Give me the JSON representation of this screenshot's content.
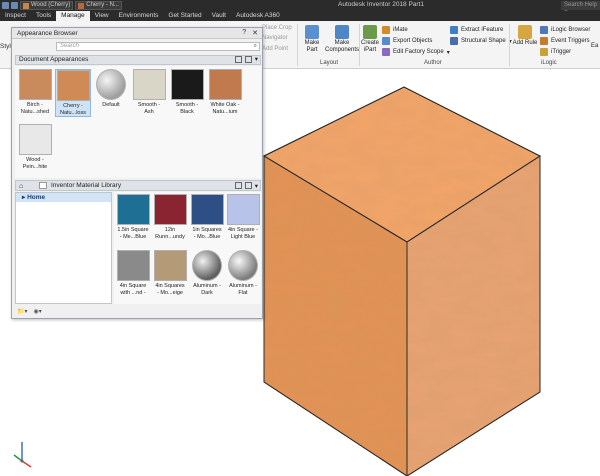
{
  "titlebar": {
    "app_title": "Autodesk Inventor 2018   Part1",
    "material_combo": "Wood (Cherry)",
    "appearance_combo": "Cherry - N...",
    "help_search_placeholder": "Search Help F"
  },
  "tabs": [
    "Inspect",
    "Tools",
    "Manage",
    "View",
    "Environments",
    "Get Started",
    "Vault",
    "Autodesk A360"
  ],
  "active_tab": "Manage",
  "ribbon": {
    "left_cut_label": "Style",
    "dimmed_items": [
      "Place Crop",
      "Navigator",
      "Add Point"
    ],
    "make_part": "Make\nPart",
    "make_components": "Make\nComponents",
    "create_ipart": "Create\niPart",
    "imate": "iMate",
    "export_objects": "Export Objects",
    "edit_factory_scope": "Edit Factory Scope",
    "extract_ifeature": "Extract iFeature",
    "structural_shape": "Structural Shape",
    "add_rule": "Add Rule",
    "ilogic_browser": "iLogic Browser",
    "event_triggers": "Event Triggers",
    "itrigger": "iTrigger",
    "groups": {
      "layout": "Layout",
      "author": "Author",
      "ilogic": "iLogic"
    },
    "cut_right": "Ea"
  },
  "browser": {
    "title": "Appearance Browser",
    "search_placeholder": "Search",
    "doc_header": "Document Appearances",
    "doc_tiles": [
      {
        "label": "Birch -\nNatu...shed",
        "color": "#c98a5c"
      },
      {
        "label": "Cherry -\nNatu...loss",
        "color": "#d08a55"
      },
      {
        "label": "Default",
        "color": "#bdbdbd"
      },
      {
        "label": "Smooth -\nAsh",
        "color": "#d9d6c8"
      },
      {
        "label": "Smooth -\nBlack",
        "color": "#1a1a1a"
      },
      {
        "label": "White Oak -\nNatu...ium",
        "color": "#c07a4d"
      },
      {
        "label": "Wood -\nPein...hite",
        "color": "#e8e8e8"
      }
    ],
    "library_name": "Inventor Material Library",
    "tree_home": "Home",
    "lib_tiles": [
      {
        "label": "1.5in Square\n- Me...Blue",
        "color": "#1f6f95"
      },
      {
        "label": "12in\nRunn...undy",
        "color": "#8a2430"
      },
      {
        "label": "1in Squares\n- Mo...Blue",
        "color": "#2d4f86"
      },
      {
        "label": "4in Square -\nLight Blue",
        "color": "#b8c3ea"
      },
      {
        "label": "4in Square\nwith ...nd -",
        "color": "#8a8a8a"
      },
      {
        "label": "4in Squares\n- Mo...eige",
        "color": "#b59a78"
      },
      {
        "label": "Aluminum -\nDark",
        "color": "#7b7b7b"
      },
      {
        "label": "Aluminum -\nFlat",
        "color": "#9d9d9d"
      }
    ]
  },
  "colors": {
    "cube_top": "#f4a569",
    "cube_left": "#e49254",
    "cube_right": "#e9a373",
    "edge": "#2a2a2a"
  }
}
